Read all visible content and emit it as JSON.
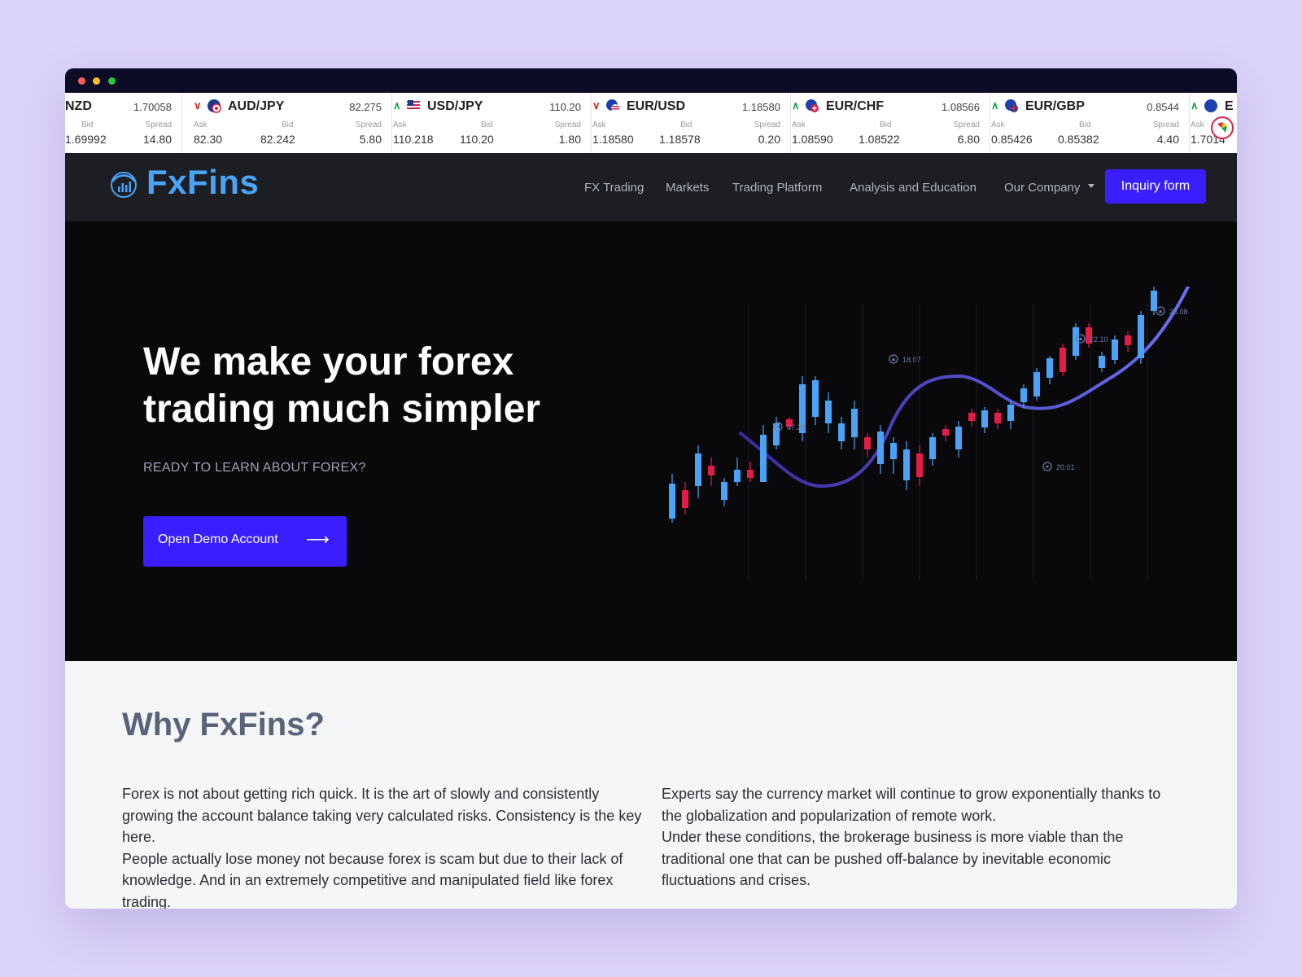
{
  "ticker": [
    {
      "pair": "NZD",
      "price": "1.70058",
      "direction": "none",
      "labels": {
        "ask": "",
        "bid": "Bid",
        "spread": "Spread"
      },
      "ask": "",
      "bid": "1.69992",
      "spread": "14.80"
    },
    {
      "pair": "AUD/JPY",
      "price": "82.275",
      "direction": "down",
      "labels": {
        "ask": "Ask",
        "bid": "Bid",
        "spread": "Spread"
      },
      "ask": "82.30",
      "bid": "82.242",
      "spread": "5.80"
    },
    {
      "pair": "USD/JPY",
      "price": "110.20",
      "direction": "up",
      "labels": {
        "ask": "Ask",
        "bid": "Bid",
        "spread": "Spread"
      },
      "ask": "110.218",
      "bid": "110.20",
      "spread": "1.80"
    },
    {
      "pair": "EUR/USD",
      "price": "1.18580",
      "direction": "down",
      "labels": {
        "ask": "Ask",
        "bid": "Bid",
        "spread": "Spread"
      },
      "ask": "1.18580",
      "bid": "1.18578",
      "spread": "0.20"
    },
    {
      "pair": "EUR/CHF",
      "price": "1.08566",
      "direction": "up",
      "labels": {
        "ask": "Ask",
        "bid": "Bid",
        "spread": "Spread"
      },
      "ask": "1.08590",
      "bid": "1.08522",
      "spread": "6.80"
    },
    {
      "pair": "EUR/GBP",
      "price": "0.8544",
      "direction": "up",
      "labels": {
        "ask": "Ask",
        "bid": "Bid",
        "spread": "Spread"
      },
      "ask": "0.85426",
      "bid": "0.85382",
      "spread": "4.40"
    },
    {
      "pair": "E",
      "price": "",
      "direction": "up",
      "labels": {
        "ask": "Ask",
        "bid": "",
        "spread": ""
      },
      "ask": "1.7014",
      "bid": "",
      "spread": ""
    }
  ],
  "nav": {
    "brand": "FxFins",
    "links": [
      "FX Trading",
      "Markets",
      "Trading Platform",
      "Analysis and Education",
      "Our Company"
    ],
    "inquiry_label": "Inquiry form"
  },
  "hero": {
    "title_line1": "We make your forex",
    "title_line2": "trading much simpler",
    "subtitle": "READY TO LEARN ABOUT FOREX?",
    "cta_label": "Open Demo Account",
    "chart_tags": [
      "07.28",
      "18.07",
      "22.10",
      "25.08",
      "20.01"
    ]
  },
  "why": {
    "title": "Why FxFins?",
    "left_p1": "Forex is not about getting rich quick. It is the art of slowly and consistently growing the account balance taking very calculated risks. Consistency is the key here.",
    "left_p2": "People actually lose money not because forex is scam but due to their lack of knowledge. And in an extremely competitive and manipulated field like forex trading.",
    "right_p1": "Experts say the currency market will continue to grow exponentially thanks to the globalization and popularization of remote work.",
    "right_p2": "Under these conditions, the brokerage business is more viable than the traditional one that can be pushed off-balance by inevitable economic fluctuations and crises."
  },
  "colors": {
    "accent": "#3b1eff",
    "brand": "#4aa3f6",
    "bull": "#4aa3f6",
    "bear": "#e11d48"
  }
}
